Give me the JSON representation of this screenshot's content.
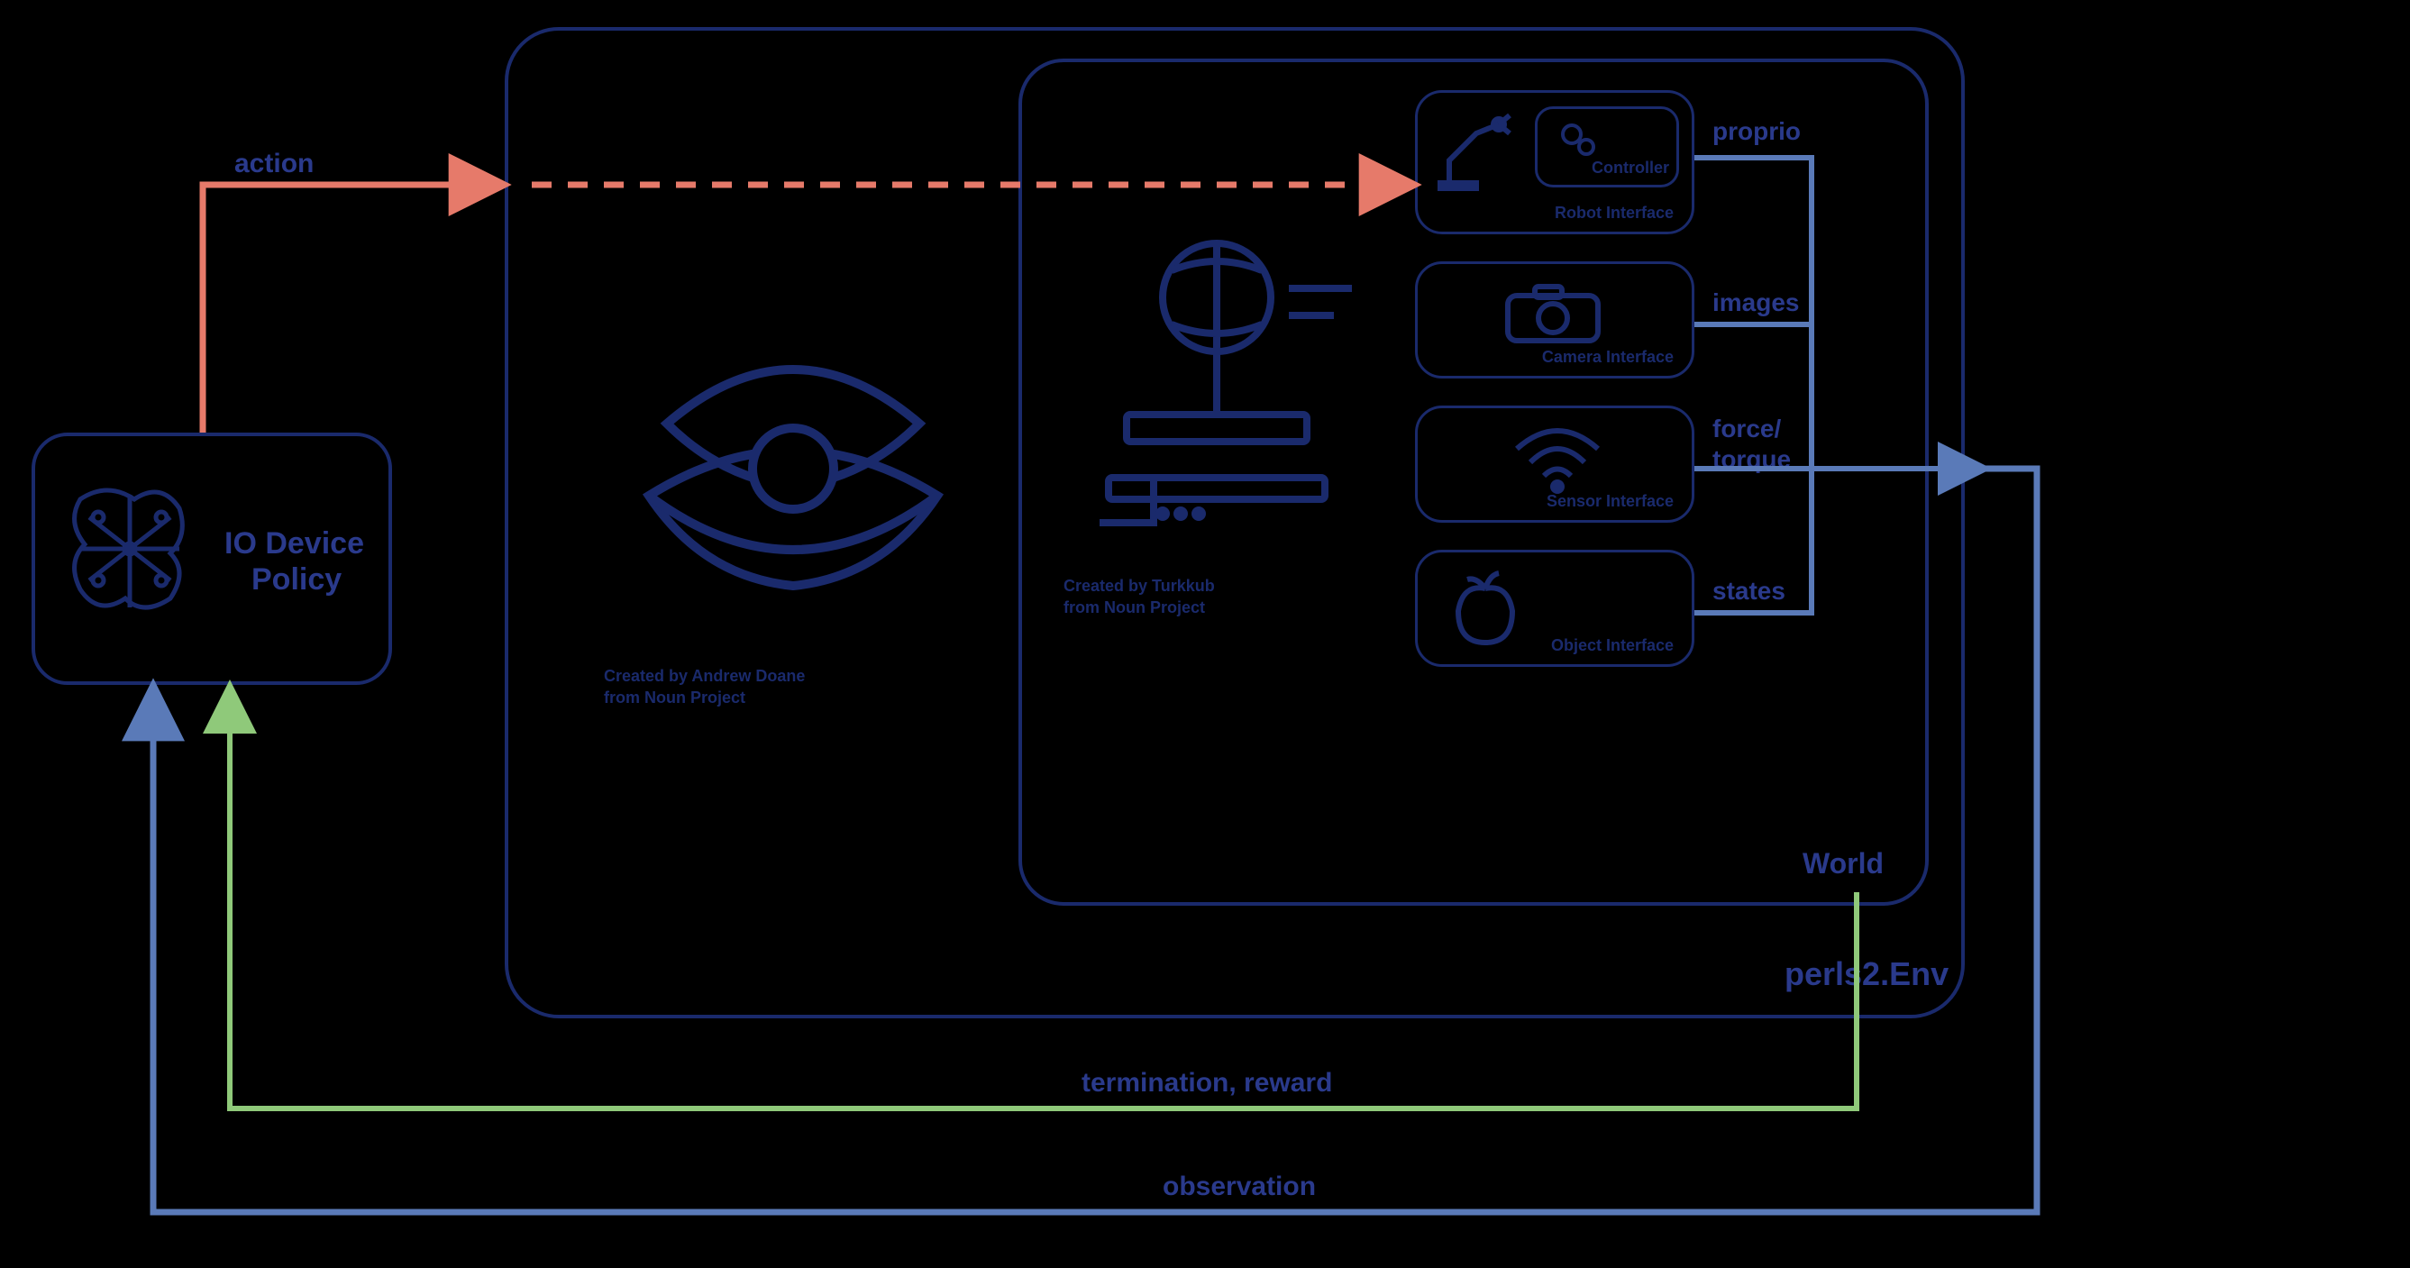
{
  "policy": {
    "title_l1": "IO Device",
    "title_l2": "Policy",
    "credit": ""
  },
  "env": {
    "title": "perls2.Env",
    "pearl_credit_l1": "Created by Andrew Doane",
    "pearl_credit_l2": "from Noun Project"
  },
  "world": {
    "title": "World",
    "manip_credit_l1": "Created by Turkkub",
    "manip_credit_l2": "from Noun Project"
  },
  "interfaces": {
    "robot": {
      "label": "Robot Interface",
      "controller": "Controller",
      "output": "proprio"
    },
    "camera": {
      "label": "Camera Interface",
      "output": "images"
    },
    "sensor": {
      "label": "Sensor Interface",
      "output_l1": "force/",
      "output_l2": "torque"
    },
    "object": {
      "label": "Object Interface",
      "output": "states"
    }
  },
  "arrows": {
    "action": "action",
    "termination": "termination, reward",
    "observation": "observation"
  },
  "colors": {
    "outline": "#1a2a6c",
    "text": "#2a3a8c",
    "action": "#e67a6a",
    "blue_arrow": "#5a7ab8",
    "green_arrow": "#8fc97a"
  }
}
